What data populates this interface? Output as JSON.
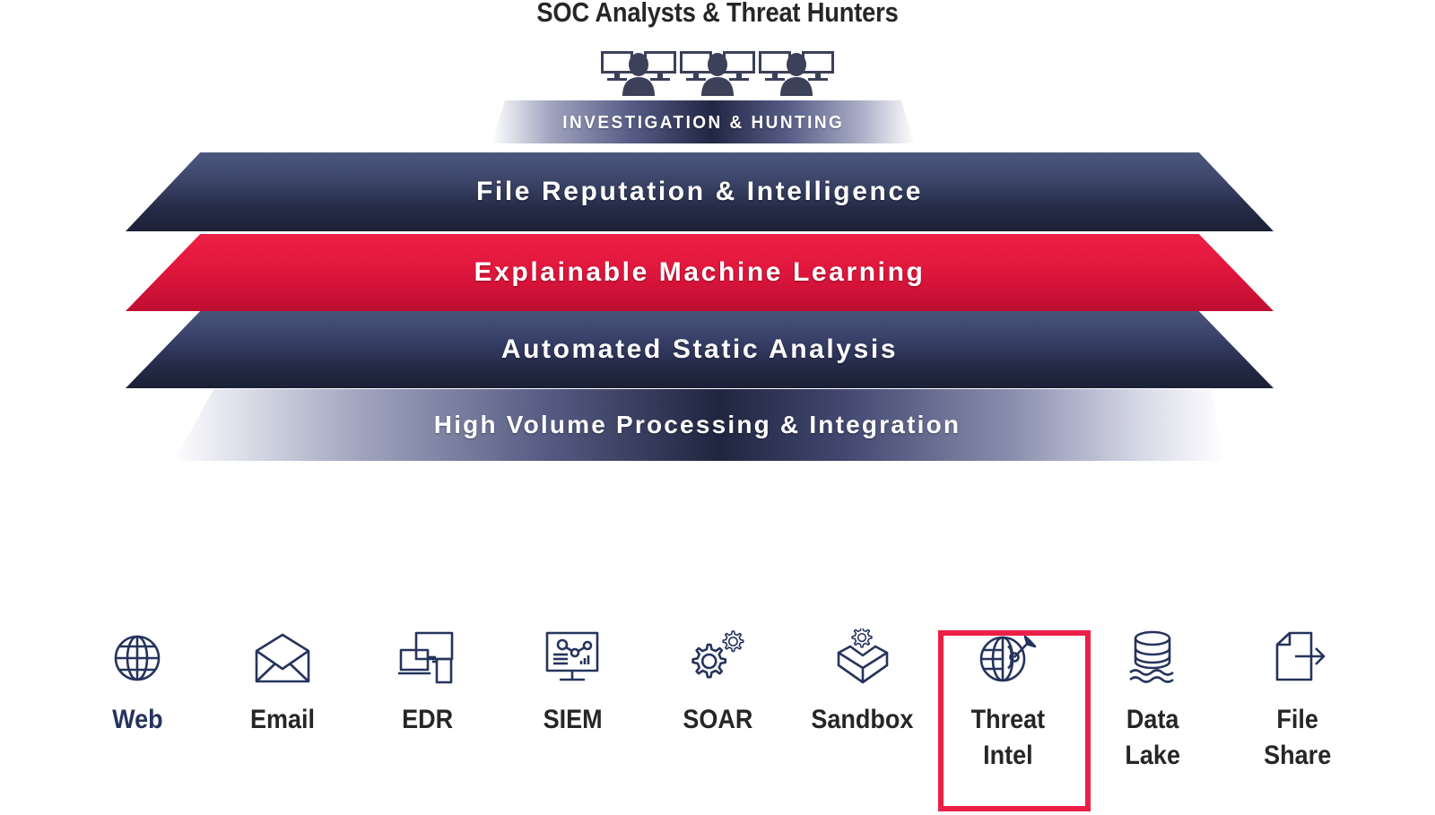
{
  "title": "SOC Analysts & Threat Hunters",
  "analysts": {
    "icon": "analyst-workstation-icon",
    "count": 3
  },
  "colors": {
    "navy_light": "#4d587f",
    "navy_dark": "#1b2036",
    "accent_red": "#ec1f45",
    "icon_navy": "#26335c",
    "label_dark": "#262626"
  },
  "layers": [
    {
      "id": "investigation-hunting",
      "label": "INVESTIGATION  &  HUNTING",
      "style": "gradient-fade-navy"
    },
    {
      "id": "file-reputation",
      "label": "File Reputation & Intelligence",
      "style": "navy"
    },
    {
      "id": "explainable-ml",
      "label": "Explainable Machine Learning",
      "style": "red"
    },
    {
      "id": "automated-static-analysis",
      "label": "Automated Static Analysis",
      "style": "navy"
    },
    {
      "id": "high-volume-processing",
      "label": "High Volume Processing & Integration",
      "style": "gradient-fade-navy"
    }
  ],
  "sources": [
    {
      "id": "web",
      "label": "Web",
      "icon": "globe-icon",
      "highlighted": false,
      "label_accent": true
    },
    {
      "id": "email",
      "label": "Email",
      "icon": "envelope-open-icon",
      "highlighted": false,
      "label_accent": false
    },
    {
      "id": "edr",
      "label": "EDR",
      "icon": "endpoint-devices-icon",
      "highlighted": false,
      "label_accent": false
    },
    {
      "id": "siem",
      "label": "SIEM",
      "icon": "monitor-analytics-icon",
      "highlighted": false,
      "label_accent": false
    },
    {
      "id": "soar",
      "label": "SOAR",
      "icon": "gears-icon",
      "highlighted": false,
      "label_accent": false
    },
    {
      "id": "sandbox",
      "label": "Sandbox",
      "icon": "open-box-gear-icon",
      "highlighted": false,
      "label_accent": false
    },
    {
      "id": "threat-intel",
      "label": "Threat\nIntel",
      "icon": "globe-target-icon",
      "highlighted": true,
      "label_accent": false
    },
    {
      "id": "data-lake",
      "label": "Data\nLake",
      "icon": "database-waves-icon",
      "highlighted": false,
      "label_accent": false
    },
    {
      "id": "file-share",
      "label": "File\nShare",
      "icon": "file-export-icon",
      "highlighted": false,
      "label_accent": false
    }
  ]
}
